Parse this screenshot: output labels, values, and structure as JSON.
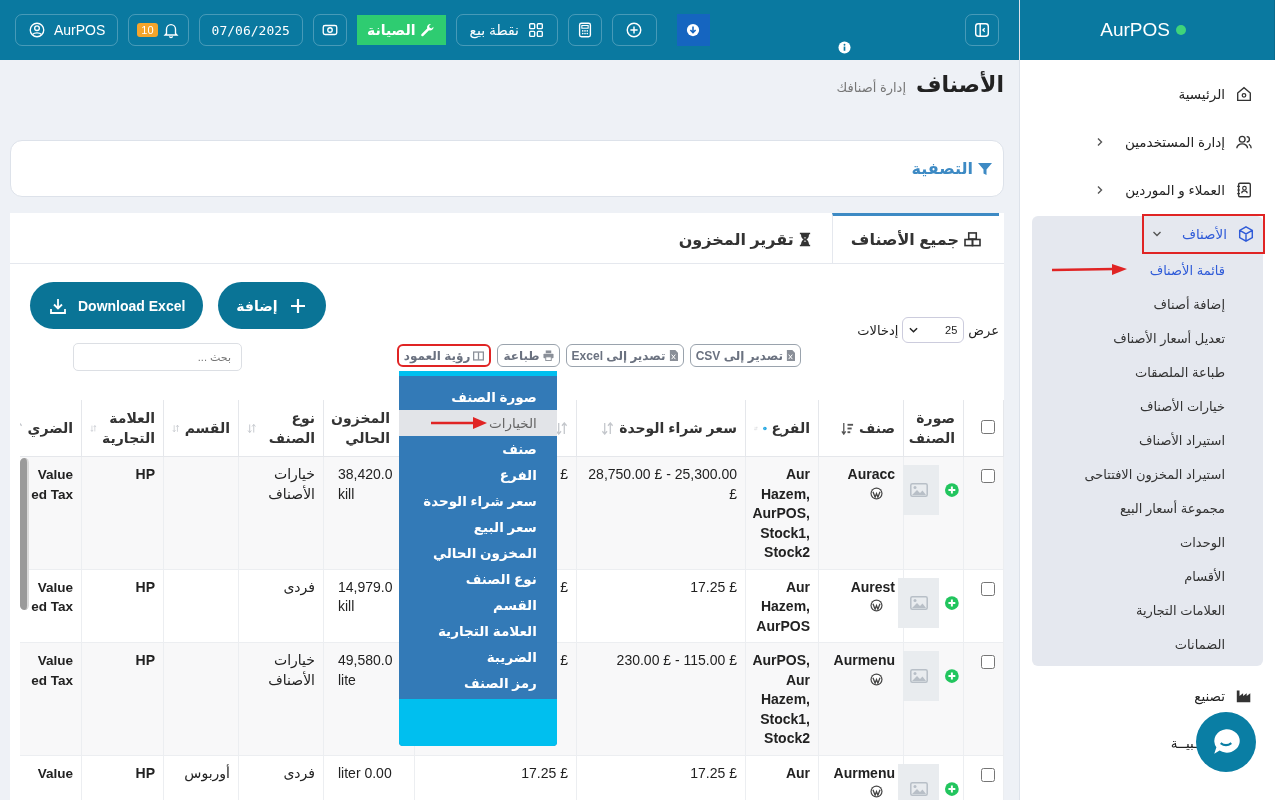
{
  "sidebar": {
    "brand": "AurPOS",
    "online": true,
    "items": [
      {
        "label": "الرئيسية",
        "selected": false,
        "highlighted": false
      },
      {
        "label": "إدارة المستخدمين",
        "expanded": false,
        "selected": false,
        "highlighted": false
      },
      {
        "label": "العملاء و الموردين",
        "expanded": false,
        "selected": false,
        "highlighted": false
      },
      {
        "label": "الأصناف",
        "expanded": true,
        "selected": true,
        "highlighted": true,
        "children": [
          {
            "label": "قائمة الأصناف",
            "selected": true,
            "pointed": true
          },
          {
            "label": "إضافة أصناف",
            "selected": false,
            "pointed": false
          },
          {
            "label": "تعديل أسعار الأصناف",
            "selected": false,
            "pointed": false
          },
          {
            "label": "طباعة الملصقات",
            "selected": false,
            "pointed": false
          },
          {
            "label": "خيارات الأصناف",
            "selected": false,
            "pointed": false
          },
          {
            "label": "استيراد الأصناف",
            "selected": false,
            "pointed": false
          },
          {
            "label": "استيراد المخزون الافتتاحى",
            "selected": false,
            "pointed": false
          },
          {
            "label": "مجموعة أسعار البيع",
            "selected": false,
            "pointed": false
          },
          {
            "label": "الوحدات",
            "selected": false,
            "pointed": false
          },
          {
            "label": "الأقسام",
            "selected": false,
            "pointed": false
          },
          {
            "label": "العلامات التجارية",
            "selected": false,
            "pointed": false
          },
          {
            "label": "الضمانات",
            "selected": false,
            "pointed": false
          }
        ]
      },
      {
        "label": "تصنيع",
        "selected": false,
        "highlighted": false
      },
      {
        "label": "ـبيــة",
        "selected": false,
        "highlighted": false
      }
    ]
  },
  "topbar": {
    "profile": "AurPOS",
    "notifications": "10",
    "date": "07/06/2025",
    "maintenance": "الصيانة",
    "pos": "نقطة بيع"
  },
  "page": {
    "title": "الأصناف",
    "subtitle": "إدارة أصنافك"
  },
  "filter": {
    "label": "التصفية"
  },
  "tabs": [
    {
      "label": "جميع الأصناف",
      "selected": true
    },
    {
      "label": "تقرير المخزون",
      "selected": false
    }
  ],
  "actions": {
    "download": "Download Excel",
    "add": "إضافة"
  },
  "length": {
    "before": "عرض",
    "value": "25",
    "after": "إدخالات"
  },
  "export_buttons": [
    {
      "label": "تصدير إلى CSV",
      "highlighted": false
    },
    {
      "label": "تصدير إلى Excel",
      "highlighted": false
    },
    {
      "label": "طباعة",
      "highlighted": false
    },
    {
      "label": "رؤية العمود",
      "highlighted": true
    }
  ],
  "search": {
    "placeholder": "بحث ..."
  },
  "column_menu": {
    "items": [
      {
        "label": "صورة الصنف",
        "selected": false,
        "pointed": false
      },
      {
        "label": "الخيارات",
        "selected": true,
        "pointed": true
      },
      {
        "label": "صنف",
        "selected": false,
        "pointed": false
      },
      {
        "label": "الفرع",
        "selected": false,
        "pointed": false
      },
      {
        "label": "سعر شراء الوحدة",
        "selected": false,
        "pointed": false
      },
      {
        "label": "سعر البيع",
        "selected": false,
        "pointed": false
      },
      {
        "label": "المخزون الحالي",
        "selected": false,
        "pointed": false
      },
      {
        "label": "نوع الصنف",
        "selected": false,
        "pointed": false
      },
      {
        "label": "القسم",
        "selected": false,
        "pointed": false
      },
      {
        "label": "العلامة التجارية",
        "selected": false,
        "pointed": false
      },
      {
        "label": "الضريبة",
        "selected": false,
        "pointed": false
      },
      {
        "label": "رمز الصنف",
        "selected": false,
        "pointed": false
      }
    ]
  },
  "table": {
    "select_all": {
      "checked": false
    },
    "columns": [
      {
        "label": "صورة الصنف"
      },
      {
        "label": "صنف",
        "sorted": true
      },
      {
        "label": "الفرع",
        "sorted": false,
        "info": true
      },
      {
        "label": "سعر شراء الوحدة",
        "sorted": false
      },
      {
        "sorted": false
      },
      {
        "label": "المخزون الحالي"
      },
      {
        "label": "نوع الصنف",
        "sorted": false
      },
      {
        "label": "القسم",
        "sorted": false
      },
      {
        "label": "العلامة التجارية",
        "sorted": false
      },
      {
        "label": "الضري",
        "sorted": false
      }
    ],
    "rows": [
      {
        "checked": false,
        "name": "Auracc",
        "branch": "Aur Hazem, AurPOS, Stock1, Stock2",
        "purchase": "28,750.00 £ - 25,300.00 £",
        "sale": "£",
        "stock": "38,420.0\nkill",
        "type": "خيارات الأصناف",
        "brand": "HP",
        "tax": "Value\ned Tax"
      },
      {
        "checked": false,
        "name": "Aurest",
        "branch": "Aur Hazem, AurPOS",
        "purchase": "17.25 £",
        "sale": "£",
        "stock": "14,979.0\nkill",
        "type": "فردى",
        "brand": "HP",
        "tax": "Value\ned Tax"
      },
      {
        "checked": false,
        "name": "Aurmenu",
        "branch": "AurPOS, Aur Hazem, Stock1, Stock2",
        "purchase": "230.00 £ - 115.00 £",
        "sale": "£",
        "stock": "49,580.0\nlite",
        "type": "خيارات الأصناف",
        "brand": "HP",
        "tax": "Value\ned Tax"
      },
      {
        "checked": false,
        "name": "Aurmenu",
        "branch": "Aur",
        "purchase": "17.25 £",
        "sale": "17.25 £",
        "stock": "liter 0.00",
        "type": "فردى",
        "category": "أوربوس",
        "brand": "HP",
        "tax": "Value"
      }
    ]
  }
}
